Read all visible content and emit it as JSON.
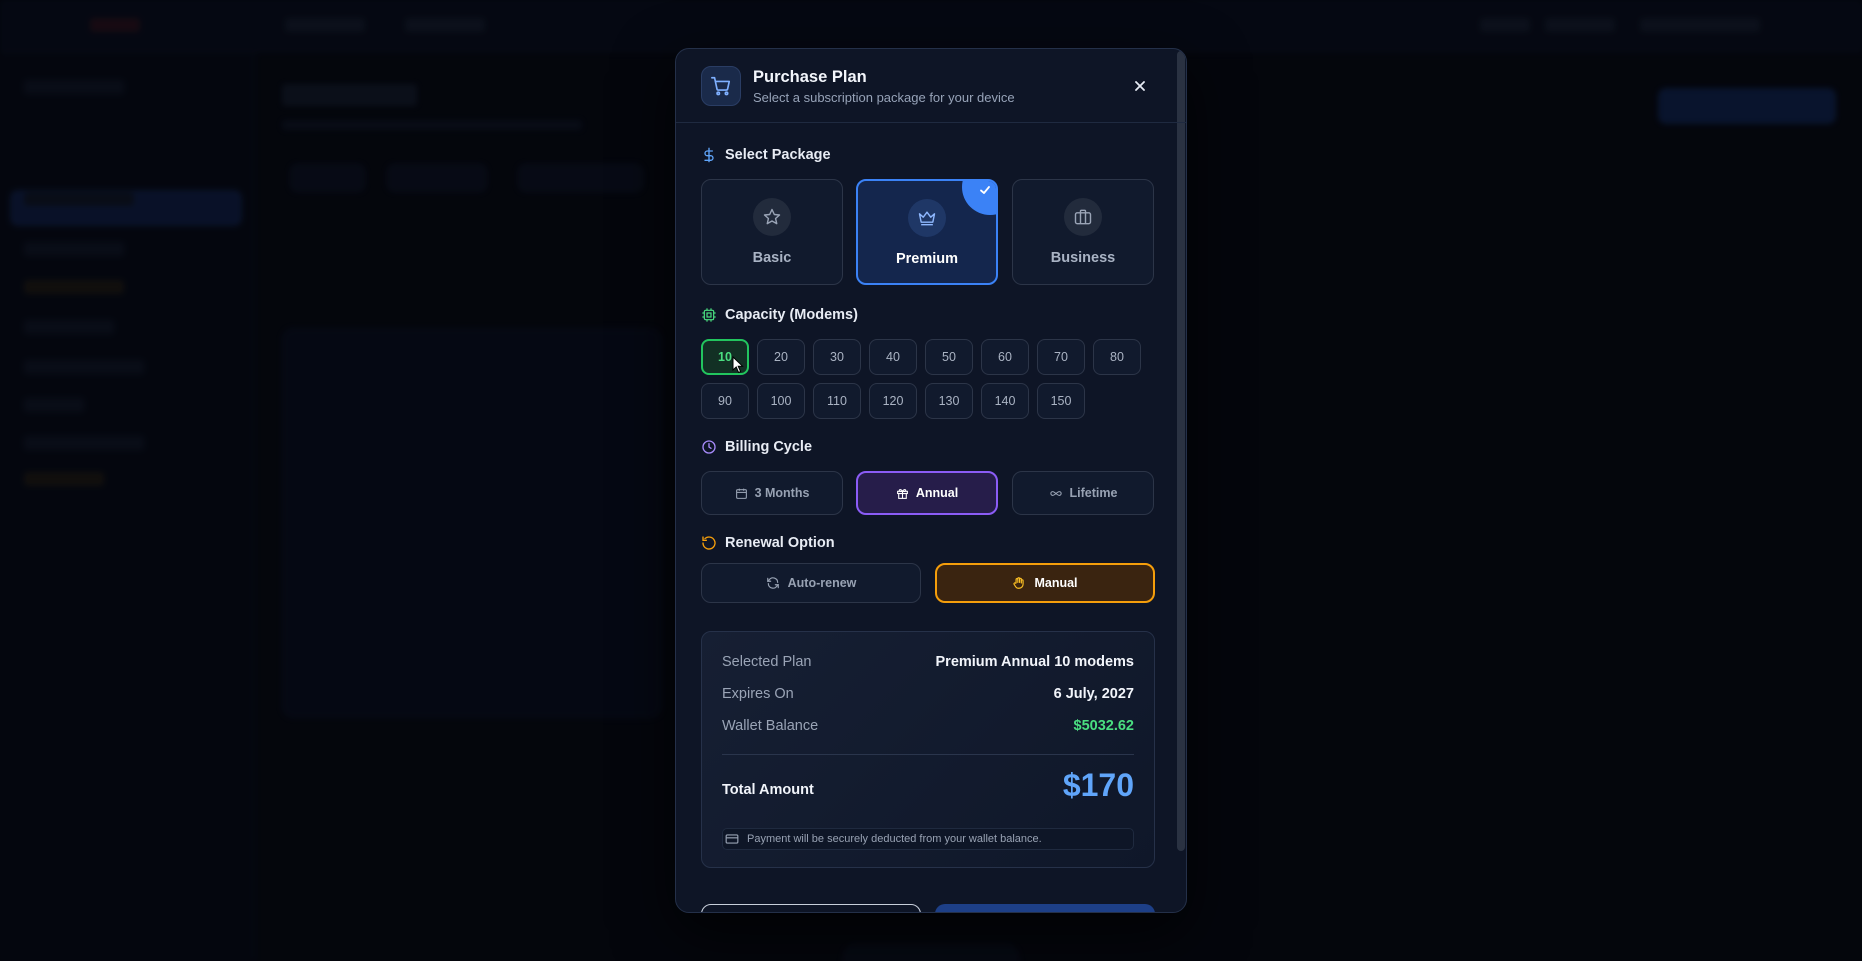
{
  "modal": {
    "title": "Purchase Plan",
    "subtitle": "Select a subscription package for your device",
    "icon": "cart-icon",
    "close_icon": "close-icon"
  },
  "sections": {
    "package_label": "Select Package",
    "capacity_label": "Capacity (Modems)",
    "billing_label": "Billing Cycle",
    "renewal_label": "Renewal Option"
  },
  "packages": [
    {
      "name": "Basic",
      "icon": "star-icon",
      "selected": false
    },
    {
      "name": "Premium",
      "icon": "crown-icon",
      "selected": true
    },
    {
      "name": "Business",
      "icon": "briefcase-icon",
      "selected": false
    }
  ],
  "capacities": [
    "10",
    "20",
    "30",
    "40",
    "50",
    "60",
    "70",
    "80",
    "90",
    "100",
    "110",
    "120",
    "130",
    "140",
    "150"
  ],
  "capacity_selected": "10",
  "billing": [
    {
      "label": "3 Months",
      "icon": "calendar-icon",
      "selected": false
    },
    {
      "label": "Annual",
      "icon": "gift-icon",
      "selected": true
    },
    {
      "label": "Lifetime",
      "icon": "infinity-icon",
      "selected": false
    }
  ],
  "renewal": [
    {
      "label": "Auto-renew",
      "icon": "refresh-icon",
      "selected": false
    },
    {
      "label": "Manual",
      "icon": "hand-icon",
      "selected": true
    }
  ],
  "summary": {
    "selected_plan_label": "Selected Plan",
    "selected_plan_value": "Premium Annual 10 modems",
    "expires_label": "Expires On",
    "expires_value": "6 July, 2027",
    "wallet_label": "Wallet Balance",
    "wallet_value": "$5032.62",
    "total_label": "Total Amount",
    "total_value": "$170",
    "payment_note": "Payment will be securely deducted from your wallet balance."
  },
  "colors": {
    "accent_blue": "#3b82f6",
    "capacity_green": "#22c55e",
    "billing_purple": "#8b5cf6",
    "renewal_orange": "#f59e0b",
    "wallet_green": "#4ade80",
    "total_blue": "#60a5fa"
  }
}
